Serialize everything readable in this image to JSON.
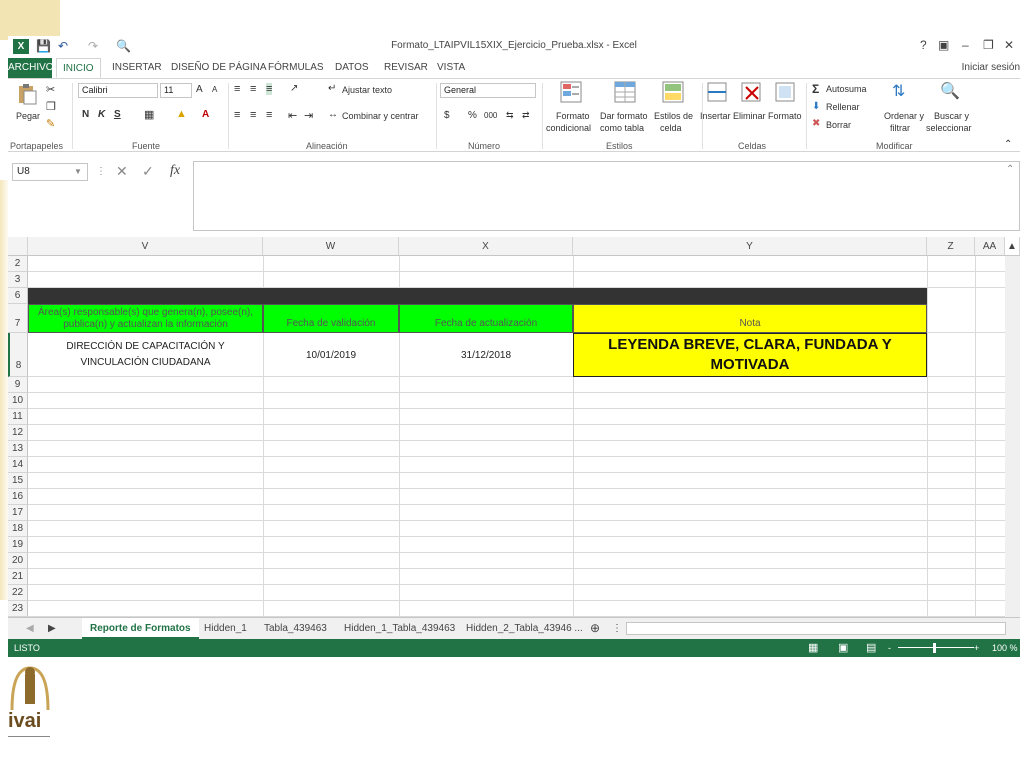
{
  "window": {
    "title": "Formato_LTAIPVIL15XIX_Ejercicio_Prueba.xlsx - Excel",
    "help": "?",
    "signin": "Iniciar sesión"
  },
  "tabs": [
    "ARCHIVO",
    "INICIO",
    "INSERTAR",
    "DISEÑO DE PÁGINA",
    "FÓRMULAS",
    "DATOS",
    "REVISAR",
    "VISTA"
  ],
  "ribbon": {
    "portapapeles": {
      "paste": "Pegar",
      "group": "Portapapeles"
    },
    "fuente": {
      "font": "Calibri",
      "size": "11",
      "bold": "N",
      "italic": "K",
      "underline": "S",
      "group": "Fuente",
      "grow": "A",
      "shrink": "A",
      "fontcolor": "A"
    },
    "alineacion": {
      "wrap": "Ajustar texto",
      "merge": "Combinar y centrar",
      "group": "Alineación"
    },
    "numero": {
      "format": "General",
      "currency": "$",
      "percent": "%",
      "thousands": "000",
      "group": "Número"
    },
    "estilos": {
      "cond1": "Formato",
      "cond2": "condicional",
      "table1": "Dar formato",
      "table2": "como tabla",
      "cell1": "Estilos de",
      "cell2": "celda",
      "group": "Estilos"
    },
    "celdas": {
      "insert": "Insertar",
      "delete": "Eliminar",
      "format": "Formato",
      "group": "Celdas"
    },
    "modificar": {
      "autosum": "Autosuma",
      "fill": "Rellenar",
      "clear": "Borrar",
      "sort1": "Ordenar y",
      "sort2": "filtrar",
      "find1": "Buscar y",
      "find2": "seleccionar",
      "group": "Modificar"
    }
  },
  "formula_bar": {
    "namebox": "U8",
    "fx": "fx",
    "value": ""
  },
  "columns": [
    "V",
    "W",
    "X",
    "Y",
    "Z",
    "AA"
  ],
  "rows": [
    "2",
    "3",
    "6",
    "7",
    "8",
    "9",
    "10",
    "11",
    "12",
    "13",
    "14",
    "15",
    "16",
    "17",
    "18",
    "19",
    "20",
    "21",
    "22",
    "23"
  ],
  "headers": {
    "v7": "Área(s) responsable(s) que genera(n), posee(n), publica(n) y actualizan la información",
    "w7": "Fecha de validación",
    "x7": "Fecha de actualización",
    "y7": "Nota"
  },
  "data_row": {
    "v8": "DIRECCIÓN DE CAPACITACIÓN Y VINCULACIÓN CIUDADANA",
    "w8": "10/01/2019",
    "x8": "31/12/2018",
    "y8": "LEYENDA BREVE, CLARA, FUNDADA Y MOTIVADA"
  },
  "sheets": [
    "Reporte de Formatos",
    "Hidden_1",
    "Tabla_439463",
    "Hidden_1_Tabla_439463",
    "Hidden_2_Tabla_43946 ..."
  ],
  "status": {
    "state": "LISTO",
    "zoom": "100 %",
    "minus": "-",
    "plus": "+"
  },
  "logo": {
    "text": "ivai"
  },
  "colors": {
    "excel_green": "#217346",
    "header_green": "#00ff00",
    "note_yellow": "#ffff00",
    "dark_band": "#333333"
  }
}
